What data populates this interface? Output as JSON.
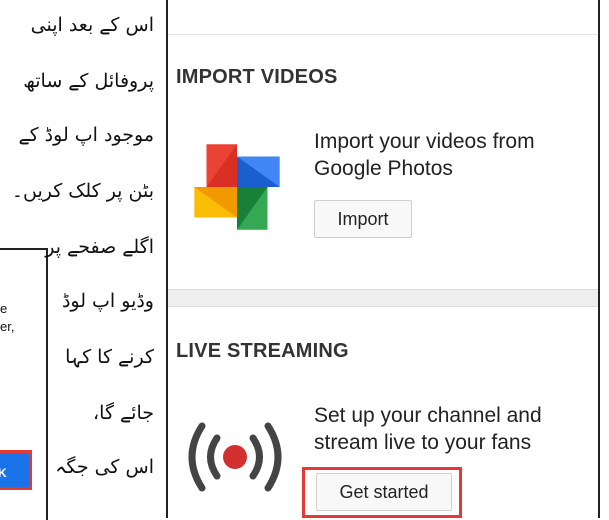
{
  "left_fragment": {
    "lines": [
      "e",
      "er,"
    ],
    "ok_label": "K"
  },
  "urdu_lines": [
    "اس کے بعد اپنی",
    "پروفائل کے ساتھ",
    "موجود اپ لوڈ کے",
    "بٹن پر کلک کریں۔",
    "اگلے صفحے پر",
    "وڈیو اپ لوڈ",
    "کرنے کا کہا",
    "جائے گا،",
    "اس کی جگہ"
  ],
  "import_section": {
    "title": "IMPORT VIDEOS",
    "description": "Import your videos from Google Photos",
    "button_label": "Import",
    "icon": "google-photos-pinwheel"
  },
  "live_section": {
    "title": "LIVE STREAMING",
    "description": "Set up your channel and stream live to your fans",
    "button_label": "Get started",
    "icon": "live-broadcast",
    "highlight_color": "#e53935"
  },
  "colors": {
    "accent_blue": "#1a73e8",
    "highlight_red": "#e53935",
    "live_dot": "#d32f2f"
  }
}
